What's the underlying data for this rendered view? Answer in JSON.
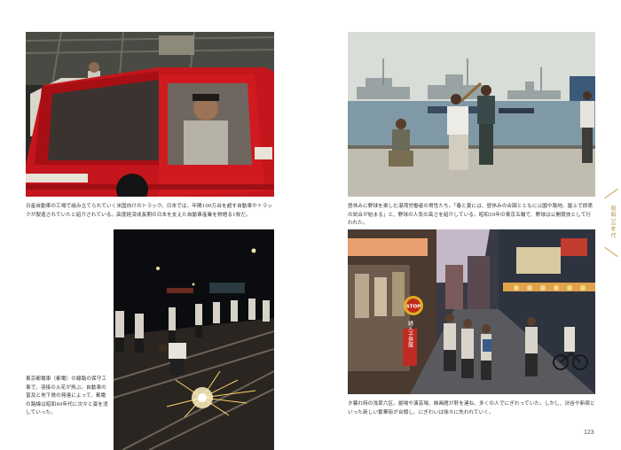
{
  "page": {
    "number": "123",
    "side_tab": "昭和30年代"
  },
  "captions": {
    "car_factory": "日産自動車の工場で組み立てられていく米国向けのトラック。日本では、年間100万台を超す自動車やトラックが製造されていたと紹介されている。高度経済成長期の日本を支えた自動車産業を物語る1枚だ。",
    "baseball_port": "昼休みに野球を楽しむ港湾労働者の男性たち。「春と夏には、昼休みの合図とともに公園や路地、屋上で即席の試合が始まる」と、野球の人気の高さを紹介している。昭和39年の東京五輪で、野球は公開競技として行われた。",
    "tram_repair": "東京都電車（都電）の線路の保守工事で、溶接の火花が飛ぶ。自動車の普及と地下鉄の発達によって、都電の路線は昭和40年代に次々と姿を消していった。",
    "asakusa": "夕暮れ時の浅草六区。劇場や演芸場、映画館が軒を連ね、多くの人でにぎわっていた。しかし、渋谷や新宿といった新しい繁華街が台頭し、にぎわいは徐々に失われていく。"
  },
  "signs": {
    "stop": "STOP",
    "store_vertical": "婦人子供服"
  }
}
